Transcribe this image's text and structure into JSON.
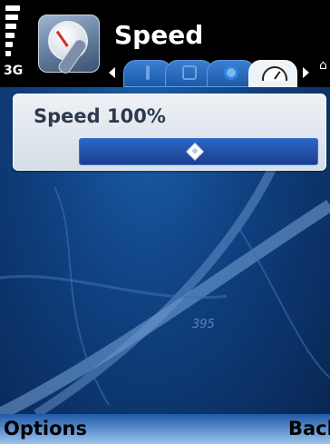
{
  "status": {
    "network": "3G"
  },
  "header": {
    "title": "Speed"
  },
  "tabs": [
    {
      "icon": "pin-icon",
      "active": false
    },
    {
      "icon": "grid-icon",
      "active": false
    },
    {
      "icon": "target-icon",
      "active": false
    },
    {
      "icon": "speedometer-icon",
      "active": true
    }
  ],
  "setting": {
    "label": "Speed 100%",
    "value_percent": 100,
    "thumb_fraction": 0.48
  },
  "map": {
    "road_label": "395"
  },
  "softkeys": {
    "left": "Options",
    "right": "Back"
  },
  "colors": {
    "accent": "#1d5aa8",
    "panel": "#e4eaf0",
    "softkey_bar": "#9cc3ee"
  }
}
